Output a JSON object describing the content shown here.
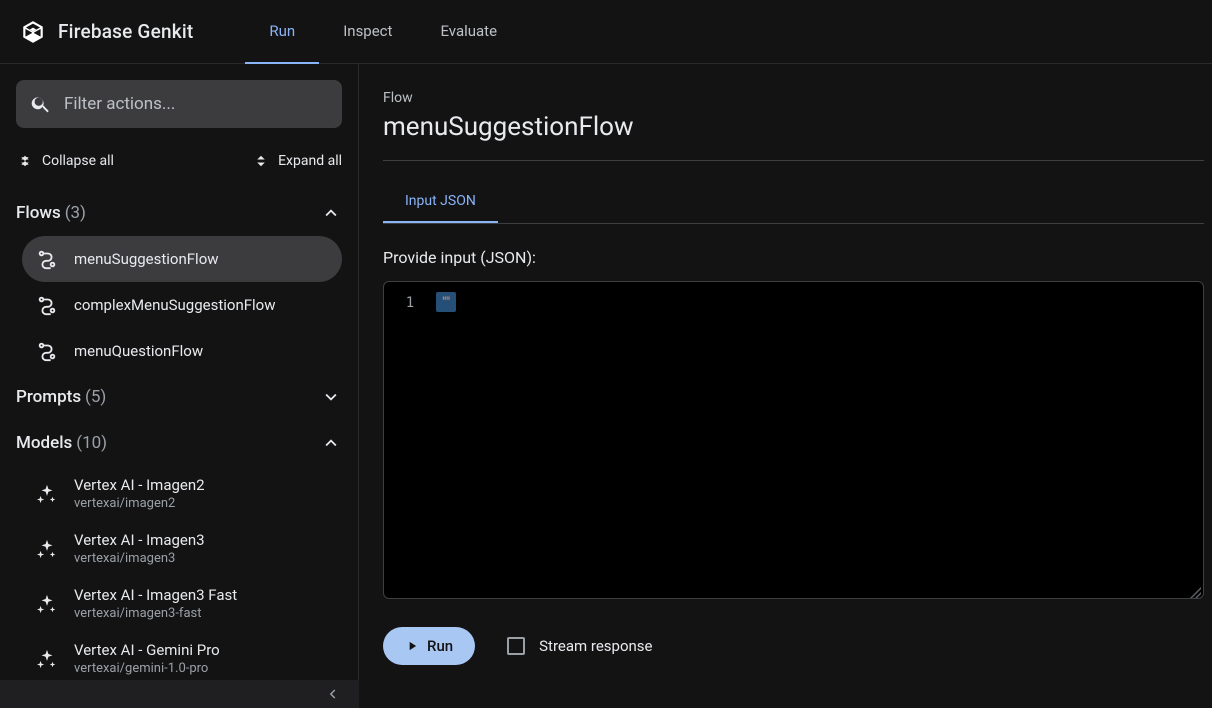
{
  "brand": "Firebase Genkit",
  "topTabs": {
    "run": "Run",
    "inspect": "Inspect",
    "evaluate": "Evaluate"
  },
  "sidebar": {
    "search_placeholder": "Filter actions...",
    "collapse_all": "Collapse all",
    "expand_all": "Expand all",
    "groups": {
      "flows": {
        "label": "Flows",
        "count": "(3)"
      },
      "prompts": {
        "label": "Prompts",
        "count": "(5)"
      },
      "models": {
        "label": "Models",
        "count": "(10)"
      }
    },
    "flows": [
      {
        "label": "menuSuggestionFlow"
      },
      {
        "label": "complexMenuSuggestionFlow"
      },
      {
        "label": "menuQuestionFlow"
      }
    ],
    "models": [
      {
        "title": "Vertex AI - Imagen2",
        "id": "vertexai/imagen2"
      },
      {
        "title": "Vertex AI - Imagen3",
        "id": "vertexai/imagen3"
      },
      {
        "title": "Vertex AI - Imagen3 Fast",
        "id": "vertexai/imagen3-fast"
      },
      {
        "title": "Vertex AI - Gemini Pro",
        "id": "vertexai/gemini-1.0-pro"
      }
    ]
  },
  "main": {
    "label": "Flow",
    "title": "menuSuggestionFlow",
    "subtab": "Input JSON",
    "input_label": "Provide input (JSON):",
    "line_number": "1",
    "code_value": "\"\"",
    "run_button": "Run",
    "stream_label": "Stream response"
  }
}
